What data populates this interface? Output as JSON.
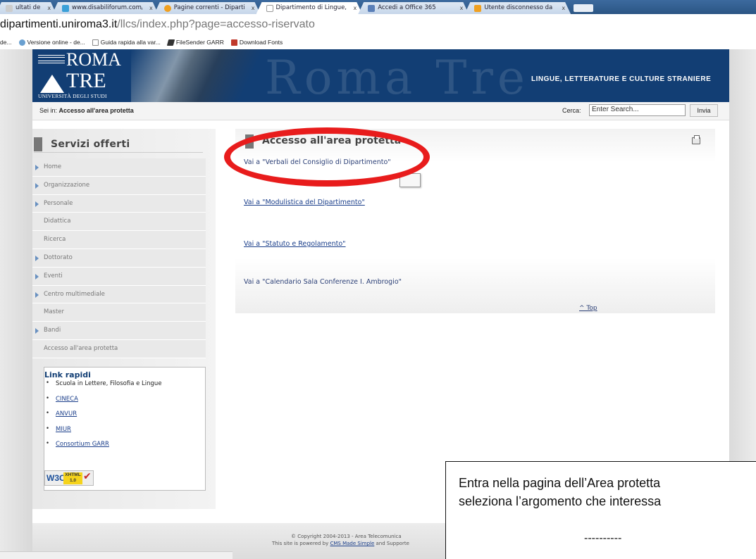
{
  "browser": {
    "tabs": [
      {
        "title": "ultati de",
        "icon_color": "#cccccc",
        "active": false
      },
      {
        "title": "www.disabiliforum.com/",
        "icon_color": "#3aa0d8",
        "active": false
      },
      {
        "title": "Pagine correnti - Dipartim",
        "icon_color": "#f0a020",
        "active": false
      },
      {
        "title": "Dipartimento di Lingue, L",
        "icon_color": "#ffffff",
        "active": true
      },
      {
        "title": "Accedi a Office 365",
        "icon_color": "#5a7fb8",
        "active": false
      },
      {
        "title": "Utente disconnesso da Of",
        "icon_color": "#f0a020",
        "active": false
      }
    ],
    "tab_close": "x",
    "url_domain": "dipartimenti.uniroma3.it",
    "url_path": "/llcs/index.php?page=accesso-riservato",
    "bookmarks": [
      {
        "label": "de...",
        "icon_color": "#ffffff"
      },
      {
        "label": "Versione online - de...",
        "icon_color": "#6aa0d0"
      },
      {
        "label": "Guida rapida alla var...",
        "icon_color": "#e0e0e0"
      },
      {
        "label": "FileSender GARR",
        "icon_color": "#333333"
      },
      {
        "label": "Download Fonts",
        "icon_color": "#c0392b"
      }
    ]
  },
  "header": {
    "logo_word1": "ROMA",
    "logo_word2": "TRE",
    "logo_university": "UNIVERSITÀ DEGLI STUDI",
    "banner_ghost": "Roma Tre",
    "department": "LINGUE, LETTERATURE E CULTURE STRANIERE",
    "brand_color": "#123e74"
  },
  "crumbbar": {
    "prefix": "Sei in: ",
    "current": "Accesso all'area protetta",
    "search_label": "Cerca:",
    "search_value": "Enter Search...",
    "submit": "Invia"
  },
  "sidebar": {
    "title": "Servizi offerti",
    "items": [
      {
        "label": "Home",
        "arrow": true
      },
      {
        "label": "Organizzazione",
        "arrow": true
      },
      {
        "label": "Personale",
        "arrow": true
      },
      {
        "label": "Didattica",
        "arrow": false
      },
      {
        "label": "Ricerca",
        "arrow": false
      },
      {
        "label": "Dottorato",
        "arrow": true
      },
      {
        "label": "Eventi",
        "arrow": true
      },
      {
        "label": "Centro multimediale",
        "arrow": true
      },
      {
        "label": "Master",
        "arrow": false
      },
      {
        "label": "Bandi",
        "arrow": true
      },
      {
        "label": "Accesso all'area protetta",
        "arrow": false
      }
    ],
    "quicklinks_title": "Link rapidi",
    "quicklinks": [
      {
        "label": "Scuola in Lettere, Filosofia e Lingue",
        "link": false
      },
      {
        "label": "CINECA",
        "link": true
      },
      {
        "label": "ANVUR",
        "link": true
      },
      {
        "label": "MIUR",
        "link": true
      },
      {
        "label": "Consortium GARR",
        "link": true
      }
    ],
    "badge_w3c": "W3C",
    "badge_xhtml": "XHTML 1.0",
    "badge_check": "✔"
  },
  "content": {
    "title": "Accesso all'area protetta",
    "links": [
      {
        "label": "Vai a \"Verbali del Consiglio di Dipartimento\"",
        "underline": false
      },
      {
        "label": "Vai a \"Modulistica del Dipartimento\"",
        "underline": true
      },
      {
        "label": "Vai a \"Statuto e Regolamento\"",
        "underline": true
      },
      {
        "label": "Vai a \"Calendario Sala Conferenze I. Ambrogio\"",
        "underline": false
      }
    ],
    "top_link": "^ Top",
    "highlight_color": "#e81c1c"
  },
  "footer": {
    "copyright": "© Copyright 2004-2013 - Area Telecomunica",
    "powered_prefix": "This site is powered by ",
    "powered_link": "CMS Made Simple",
    "powered_suffix": " and Supporte"
  },
  "note": {
    "line1": "Entra nella pagina dell’Area protetta",
    "line2": "seleziona l’argomento che interessa",
    "line3": "----------"
  }
}
